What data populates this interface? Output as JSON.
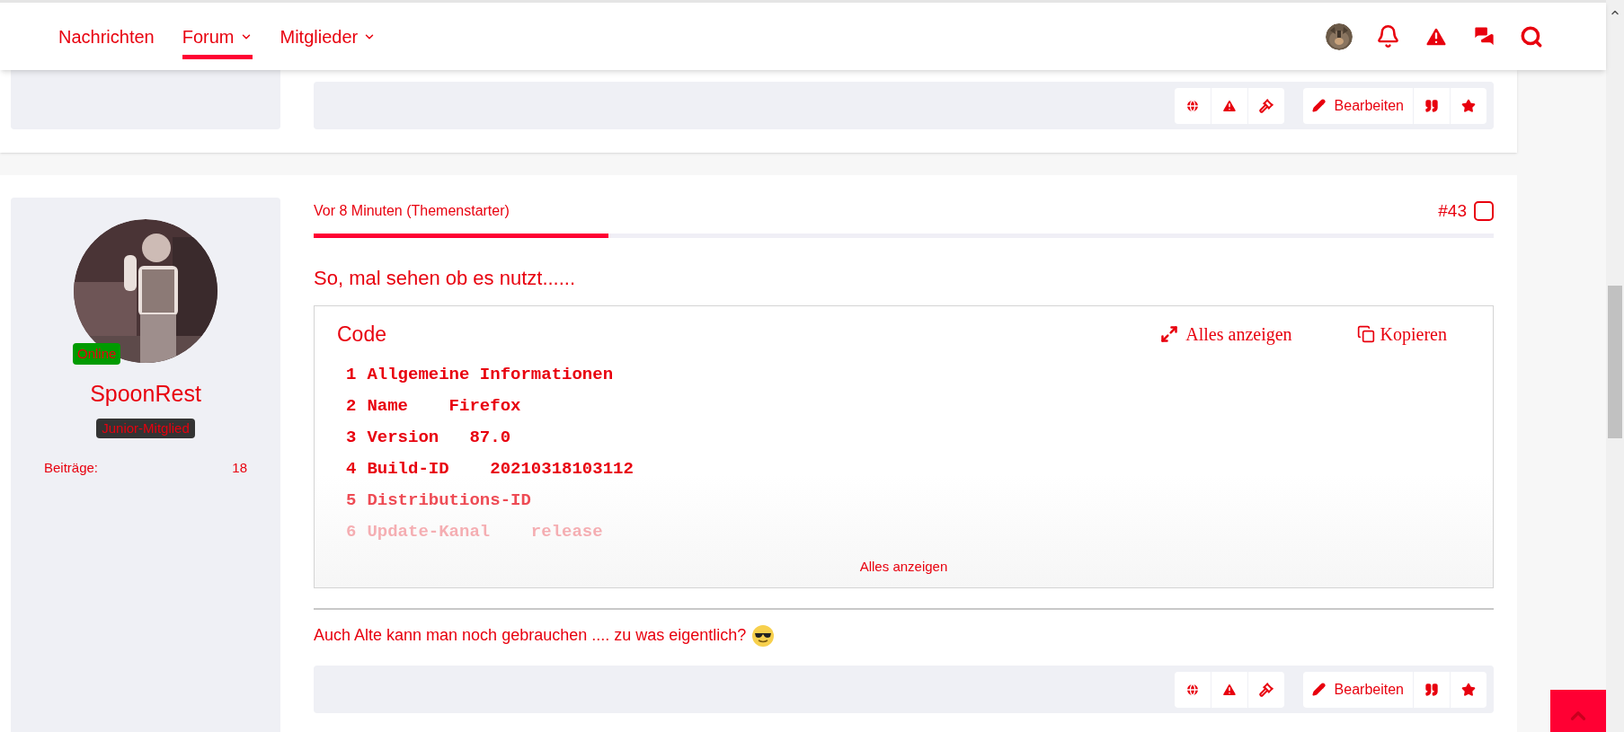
{
  "nav": {
    "items": [
      {
        "label": "Nachrichten",
        "selected": false,
        "has_menu": false
      },
      {
        "label": "Forum",
        "selected": true,
        "has_menu": true
      },
      {
        "label": "Mitglieder",
        "selected": false,
        "has_menu": true
      }
    ]
  },
  "previous_post": {
    "actions": {
      "edit_label": "Bearbeiten"
    }
  },
  "post": {
    "author": {
      "name": "SpoonRest",
      "online": true,
      "status_label": "Online",
      "rank": "Junior-Mitglied",
      "stats": [
        {
          "label": "Beiträge:",
          "value": "18"
        }
      ]
    },
    "time": "Vor 8 Minuten (Themenstarter)",
    "number": "#43",
    "selected": false,
    "read_progress": {
      "level": 0.25
    },
    "message": "So, mal sehen ob es nutzt......",
    "code": {
      "title": "Code",
      "expand_label": "Alles anzeigen",
      "copy_label": "Kopieren",
      "collapsed": true,
      "show_all_label": "Alles anzeigen",
      "lines": [
        {
          "number": "1",
          "text": "Allgemeine Informationen"
        },
        {
          "number": "2",
          "text": "Name    Firefox"
        },
        {
          "number": "3",
          "text": "Version   87.0"
        },
        {
          "number": "4",
          "text": "Build-ID    20210318103112"
        },
        {
          "number": "5",
          "text": "Distributions-ID"
        },
        {
          "number": "6",
          "text": "Update-Kanal    release"
        }
      ]
    },
    "signature": "Auch Alte kann man noch gebrauchen .... zu was eigentlich?",
    "actions": {
      "edit_label": "Bearbeiten"
    }
  }
}
